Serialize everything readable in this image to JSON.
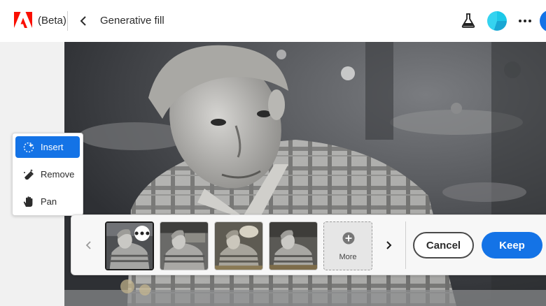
{
  "header": {
    "badge": "(Beta)",
    "title": "Generative fill",
    "brand_color": "#FA0F00"
  },
  "tools": {
    "items": [
      {
        "label": "Insert",
        "icon": "sparkle-brush-icon",
        "active": true
      },
      {
        "label": "Remove",
        "icon": "eraser-icon",
        "active": false
      },
      {
        "label": "Pan",
        "icon": "hand-icon",
        "active": false
      }
    ]
  },
  "variations": {
    "count": 4,
    "selected_index": 0,
    "more_label": "More"
  },
  "actions": {
    "cancel_label": "Cancel",
    "keep_label": "Keep",
    "accent_color": "#1473E6"
  }
}
